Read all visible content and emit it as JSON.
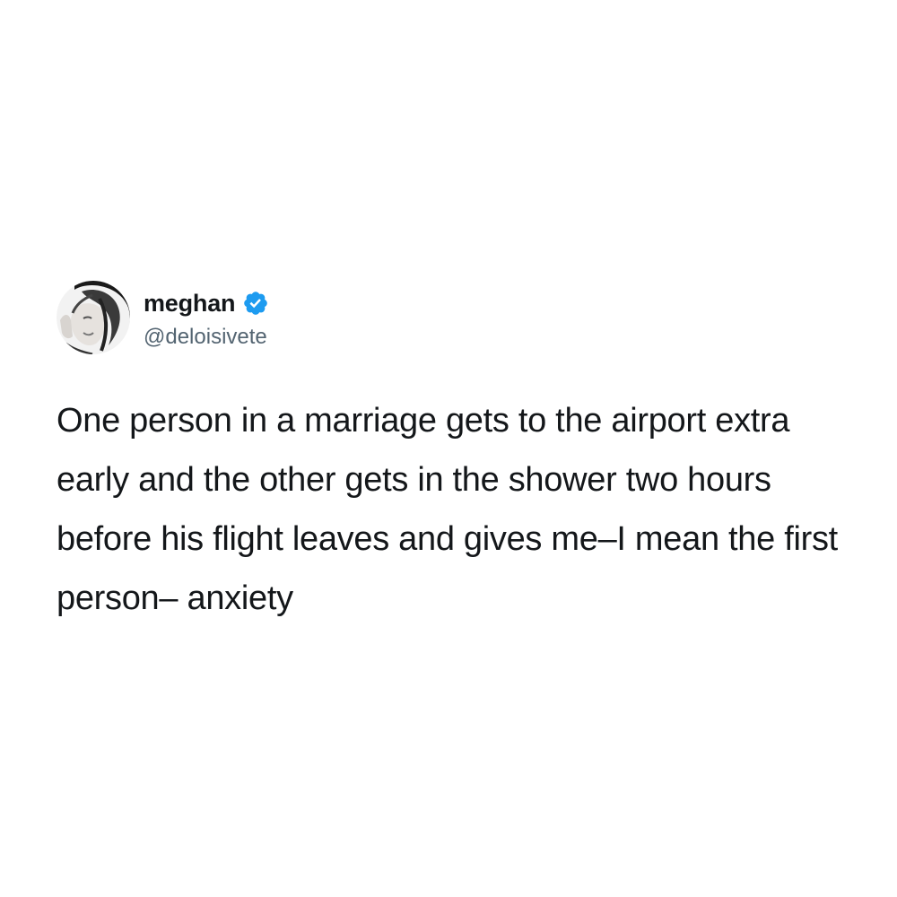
{
  "tweet": {
    "display_name": "meghan",
    "handle": "@deloisivete",
    "verified": true,
    "text": "One person in a marriage gets to the airport extra early and the other gets in the shower two hours before his flight leaves and gives me–I mean the first person– anxiety"
  },
  "icons": {
    "verified": "verified-badge-icon",
    "avatar": "profile-photo"
  },
  "colors": {
    "verified_blue": "#1d9bf0",
    "text": "#14171a",
    "handle": "#536471",
    "background": "#ffffff"
  }
}
